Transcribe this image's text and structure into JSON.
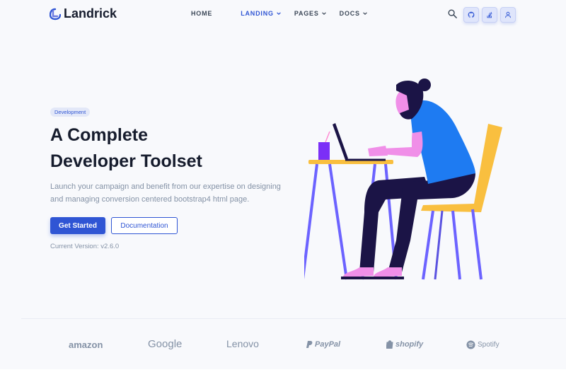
{
  "brand": {
    "name": "Landrick"
  },
  "nav": {
    "items": [
      {
        "label": "HOME",
        "dropdown": false,
        "active": false
      },
      {
        "label": "LANDING",
        "dropdown": true,
        "active": true
      },
      {
        "label": "PAGES",
        "dropdown": true,
        "active": false
      },
      {
        "label": "DOCS",
        "dropdown": true,
        "active": false
      }
    ],
    "icons": [
      "search-icon",
      "github-icon",
      "stackoverflow-icon",
      "user-icon"
    ]
  },
  "hero": {
    "badge": "Development",
    "title_line1": "A Complete",
    "title_line2": "Developer Toolset",
    "description": "Launch your campaign and benefit from our expertise on designing and managing conversion centered bootstrap4 html page.",
    "primary_button": "Get Started",
    "secondary_button": "Documentation",
    "version": "Current Version: v2.6.0"
  },
  "clients": [
    "amazon",
    "Google",
    "Lenovo",
    "PayPal",
    "shopify",
    "Spotify"
  ],
  "colors": {
    "primary": "#2f55d4",
    "heading": "#161c2d",
    "muted": "#8492a6",
    "background": "#f8f9fc"
  }
}
